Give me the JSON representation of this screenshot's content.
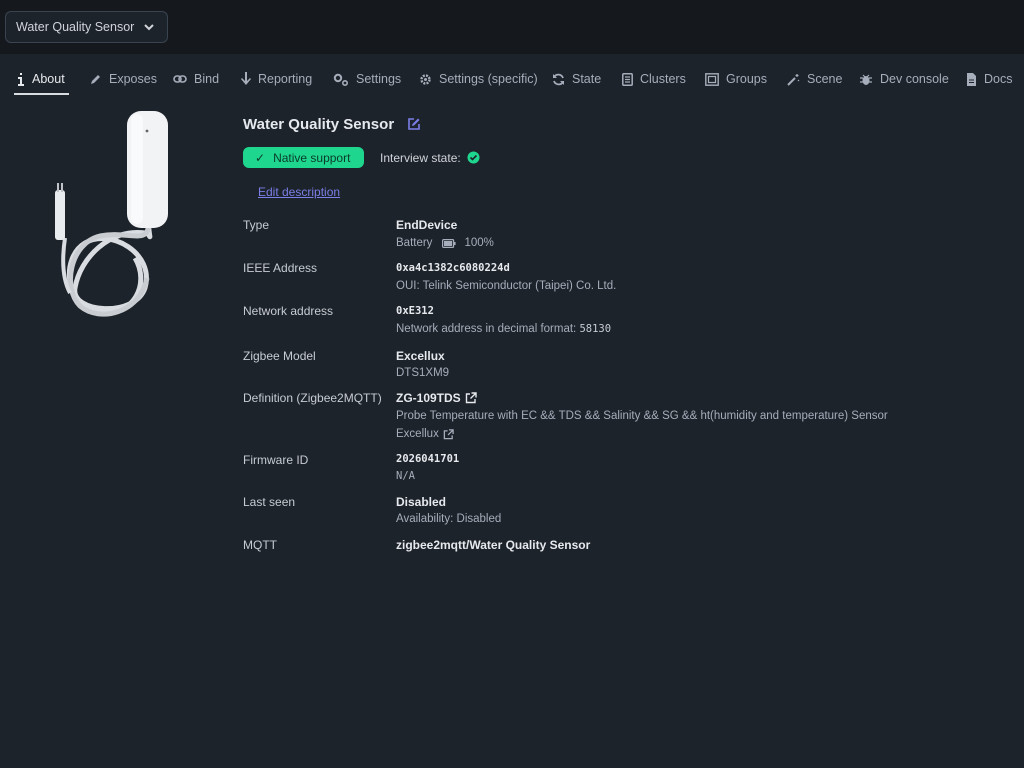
{
  "header": {
    "device_select_value": "Water Quality Sensor"
  },
  "tabs": [
    {
      "label": "About",
      "icon": "info-icon"
    },
    {
      "label": "Exposes",
      "icon": "pencil-icon"
    },
    {
      "label": "Bind",
      "icon": "link-icon"
    },
    {
      "label": "Reporting",
      "icon": "arrow-down-icon"
    },
    {
      "label": "Settings",
      "icon": "gears-icon"
    },
    {
      "label": "Settings (specific)",
      "icon": "gear-icon"
    },
    {
      "label": "State",
      "icon": "refresh-icon"
    },
    {
      "label": "Clusters",
      "icon": "list-icon"
    },
    {
      "label": "Groups",
      "icon": "object-group-icon"
    },
    {
      "label": "Scene",
      "icon": "magic-wand-icon"
    },
    {
      "label": "Dev console",
      "icon": "bug-icon"
    },
    {
      "label": "Docs",
      "icon": "document-icon"
    }
  ],
  "device": {
    "title": "Water Quality Sensor",
    "support_badge": "Native support",
    "interview_label": "Interview state:",
    "edit_description": "Edit description"
  },
  "details": {
    "type": {
      "label": "Type",
      "value": "EndDevice",
      "battery_label": "Battery",
      "battery_value": "100%"
    },
    "ieee": {
      "label": "IEEE Address",
      "value": "0xa4c1382c6080224d",
      "oui": "OUI: Telink Semiconductor (Taipei) Co. Ltd."
    },
    "network": {
      "label": "Network address",
      "value": "0xE312",
      "decimal_label": "Network address in decimal format:",
      "decimal_value": "58130"
    },
    "model": {
      "label": "Zigbee Model",
      "value": "Excellux",
      "sub": "DTS1XM9"
    },
    "definition": {
      "label": "Definition (Zigbee2MQTT)",
      "value": "ZG-109TDS",
      "description": "Probe Temperature with EC && TDS && Salinity && SG && ht(humidity and temperature) Sensor",
      "vendor": "Excellux"
    },
    "firmware": {
      "label": "Firmware ID",
      "value": "2026041701",
      "sub": "N/A"
    },
    "last_seen": {
      "label": "Last seen",
      "value": "Disabled",
      "sub": "Availability: Disabled"
    },
    "mqtt": {
      "label": "MQTT",
      "value": "zigbee2mqtt/Water Quality Sensor"
    }
  },
  "colors": {
    "background": "#1d232a",
    "topbar": "#15191e",
    "success": "#1fd68f",
    "link": "#7b7fe8"
  }
}
